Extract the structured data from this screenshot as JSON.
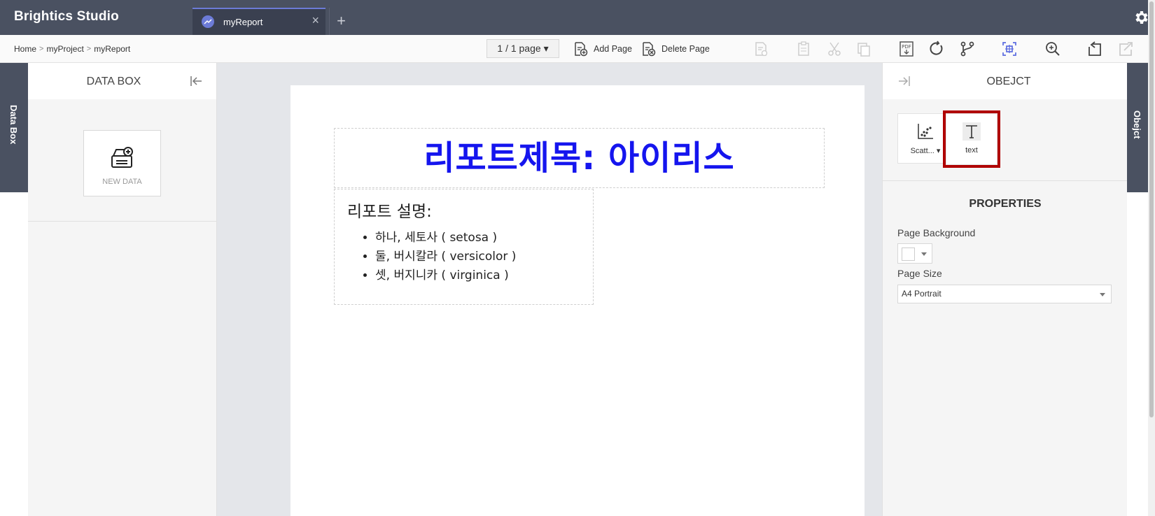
{
  "app": {
    "title": "Brightics Studio"
  },
  "tabs": [
    {
      "label": "myReport"
    }
  ],
  "breadcrumb": {
    "items": [
      "Home",
      "myProject",
      "myReport"
    ]
  },
  "toolbar": {
    "page_indicator": "1 / 1 page",
    "add_page_label": "Add Page",
    "delete_page_label": "Delete Page"
  },
  "left_rail": {
    "label": "Data Box"
  },
  "databox": {
    "title": "DATA BOX",
    "new_data_label": "NEW DATA"
  },
  "report": {
    "title": "리포트제목: 아이리스",
    "description_title": "리포트 설명:",
    "items": [
      "하나, 세토사 ( setosa )",
      "둘, 버시칼라 ( versicolor )",
      "셋, 버지니카 ( virginica )"
    ],
    "title_color": "#1515ee"
  },
  "object_panel": {
    "title": "OBEJCT",
    "objects": [
      {
        "label": "Scatt..."
      },
      {
        "label": "text"
      }
    ],
    "properties_title": "PROPERTIES",
    "page_background_label": "Page Background",
    "page_background_value": "#ffffff",
    "page_size_label": "Page Size",
    "page_size_value": "A4 Portrait"
  },
  "right_rail": {
    "label": "Obejct"
  },
  "colors": {
    "header": "#4a5161",
    "accent": "#6c7bd7",
    "highlight": "#b00000"
  }
}
